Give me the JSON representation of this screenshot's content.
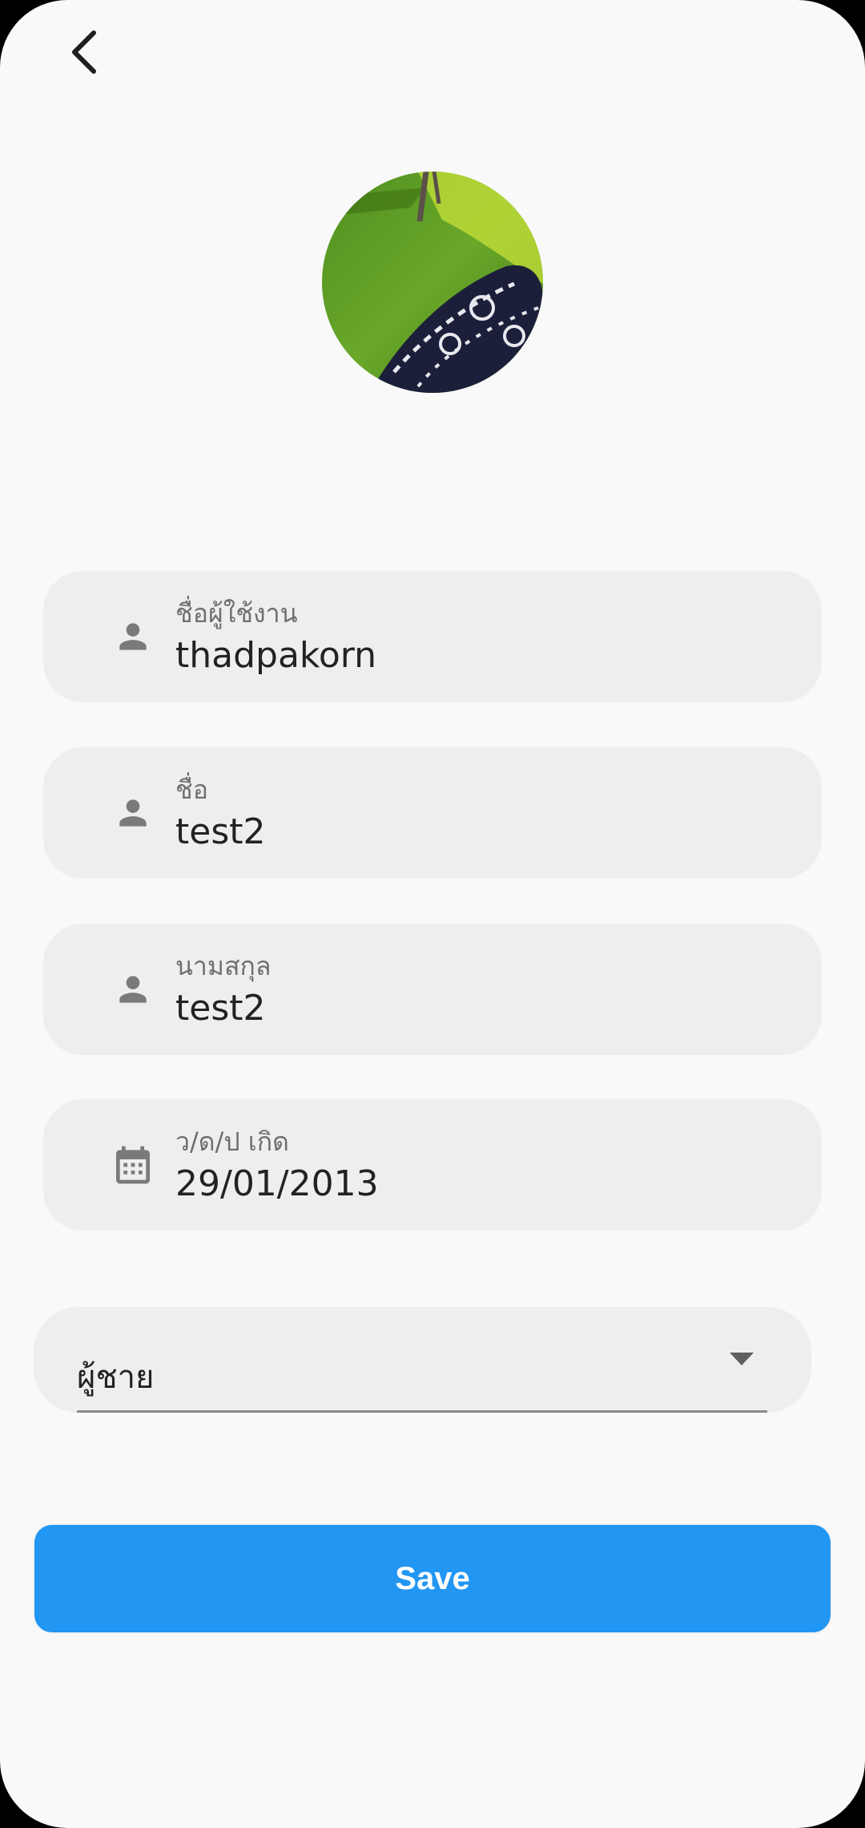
{
  "header": {
    "back_icon": "chevron-left-icon"
  },
  "profile": {
    "avatar_description": "profile-photo"
  },
  "fields": [
    {
      "label": "ชื่อผู้ใช้งาน",
      "value": "thadpakorn",
      "icon": "person-icon"
    },
    {
      "label": "ชื่อ",
      "value": "test2",
      "icon": "person-icon"
    },
    {
      "label": "นามสกุล",
      "value": "test2",
      "icon": "person-icon"
    },
    {
      "label": "ว/ด/ป เกิด",
      "value": "29/01/2013",
      "icon": "calendar-icon"
    }
  ],
  "gender": {
    "selected": "ผู้ชาย",
    "icon": "dropdown-arrow-icon"
  },
  "actions": {
    "save_label": "Save"
  },
  "colors": {
    "primary": "#2196f3",
    "background": "#f9f9f9",
    "field_background": "#eeeeee",
    "icon_gray": "#7a7a7a"
  }
}
